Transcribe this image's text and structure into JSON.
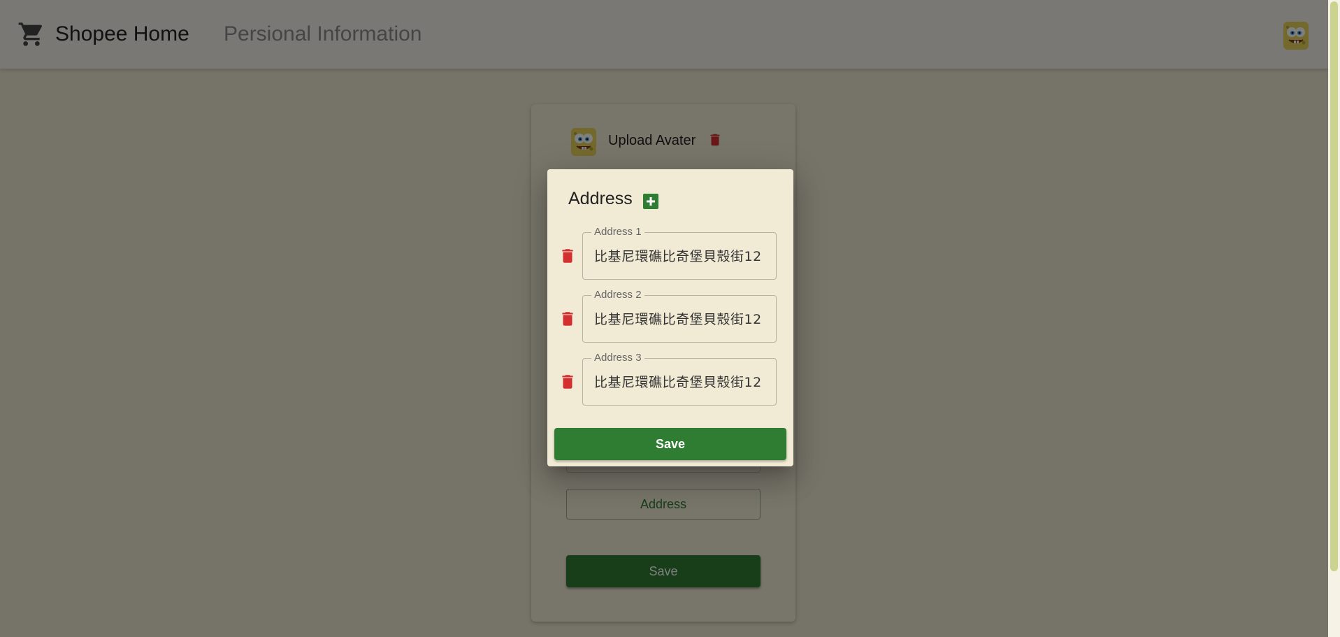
{
  "header": {
    "brand": "Shopee Home",
    "page_title": "Persional Information"
  },
  "profile_card": {
    "upload_label": "Upload Avater",
    "address_button": "Address",
    "save_label": "Save"
  },
  "address_dialog": {
    "title": "Address",
    "addresses": [
      {
        "label": "Address 1",
        "value": "比基尼環礁比奇堡貝殼街12"
      },
      {
        "label": "Address 2",
        "value": "比基尼環礁比奇堡貝殼街12"
      },
      {
        "label": "Address 3",
        "value": "比基尼環礁比奇堡貝殼街12"
      }
    ],
    "save_label": "Save"
  },
  "icons": {
    "cart": "shopping-cart-icon",
    "avatar": "spongebob-avatar",
    "delete": "trash-icon",
    "add": "add-box-icon"
  },
  "colors": {
    "primary_green": "#2e7d32",
    "danger_red": "#d32f2f",
    "surface": "#f1ead4"
  }
}
